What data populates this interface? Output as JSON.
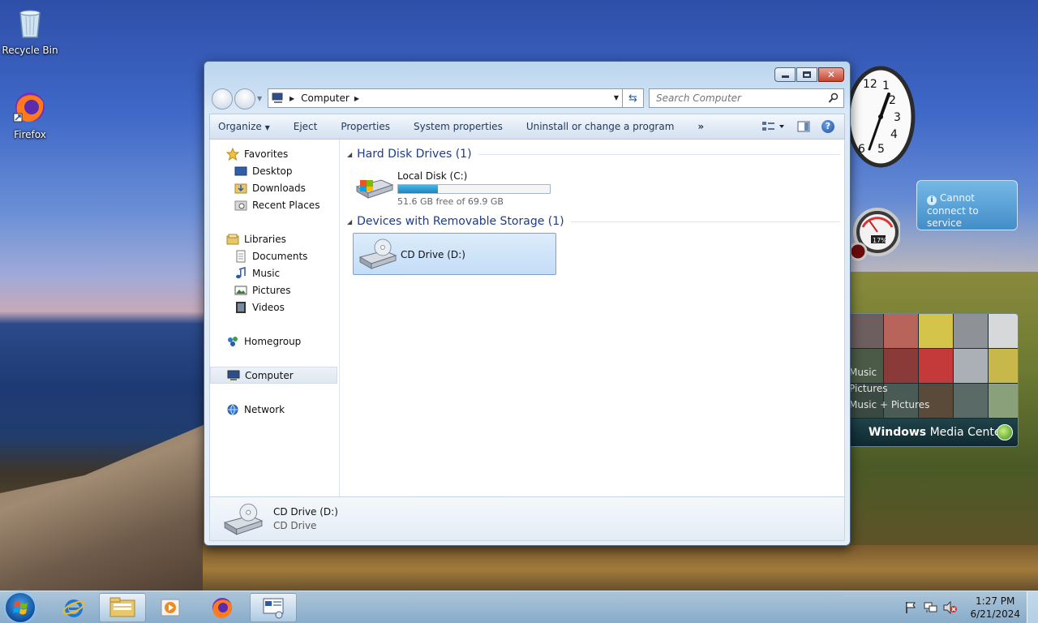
{
  "desktop": {
    "icons": [
      {
        "label": "Recycle Bin",
        "icon": "recycle-bin-icon"
      },
      {
        "label": "Firefox",
        "icon": "firefox-icon"
      }
    ]
  },
  "gadgets": {
    "clock": {
      "numbers": [
        "12",
        "1",
        "2",
        "3",
        "4",
        "5",
        "6"
      ]
    },
    "cpu": {
      "label": "17%"
    },
    "weather": {
      "message": "Cannot connect to service"
    },
    "media_center": {
      "menu": [
        "Music",
        "Pictures",
        "Music + Pictures"
      ],
      "brand_bold": "Windows",
      "brand_light": " Media Center"
    }
  },
  "window": {
    "address": {
      "location": "Computer"
    },
    "search": {
      "placeholder": "Search Computer"
    },
    "command_bar": {
      "organize": "Organize",
      "eject": "Eject",
      "properties": "Properties",
      "system_properties": "System properties",
      "uninstall": "Uninstall or change a program",
      "more": "»"
    },
    "nav_pane": {
      "favorites": "Favorites",
      "desktop": "Desktop",
      "downloads": "Downloads",
      "recent_places": "Recent Places",
      "libraries": "Libraries",
      "documents": "Documents",
      "music": "Music",
      "pictures": "Pictures",
      "videos": "Videos",
      "homegroup": "Homegroup",
      "computer": "Computer",
      "network": "Network"
    },
    "groups": {
      "hard_disks": {
        "title": "Hard Disk Drives (1)",
        "drives": [
          {
            "name": "Local Disk (C:)",
            "free_text": "51.6 GB free of 69.9 GB",
            "used_fraction": 0.262
          }
        ]
      },
      "removable": {
        "title": "Devices with Removable Storage (1)",
        "drives": [
          {
            "name": "CD Drive (D:)"
          }
        ]
      }
    },
    "details": {
      "name": "CD Drive (D:)",
      "type": "CD Drive"
    }
  },
  "taskbar": {
    "clock_time": "1:27 PM",
    "clock_date": "6/21/2024"
  },
  "colors": {
    "accent_blue": "#1e3c8a",
    "close_red": "#c4462f",
    "disk_bar": "#1a86c0"
  }
}
